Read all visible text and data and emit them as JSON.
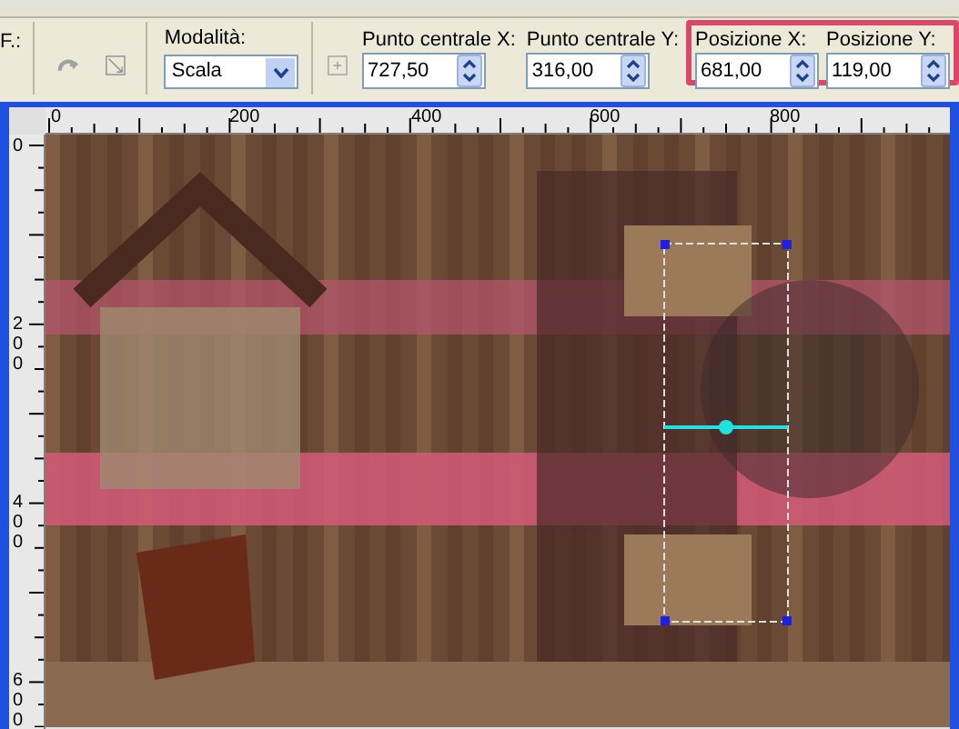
{
  "toolbar": {
    "partial_label": "F.:",
    "mode": {
      "label": "Modalità:",
      "value": "Scala"
    },
    "field_groups": [
      {
        "highlighted": false,
        "fields": [
          {
            "label": "Punto centrale X:",
            "value": "727,50"
          },
          {
            "label": "Punto centrale Y:",
            "value": "316,00"
          }
        ]
      },
      {
        "highlighted": true,
        "fields": [
          {
            "label": "Posizione X:",
            "value": "681,00"
          },
          {
            "label": "Posizione Y:",
            "value": "119,00"
          }
        ]
      }
    ]
  },
  "rulers": {
    "horizontal": [
      "0",
      "200",
      "400",
      "600",
      "800"
    ],
    "vertical": [
      "0",
      "200",
      "400",
      "600"
    ]
  }
}
